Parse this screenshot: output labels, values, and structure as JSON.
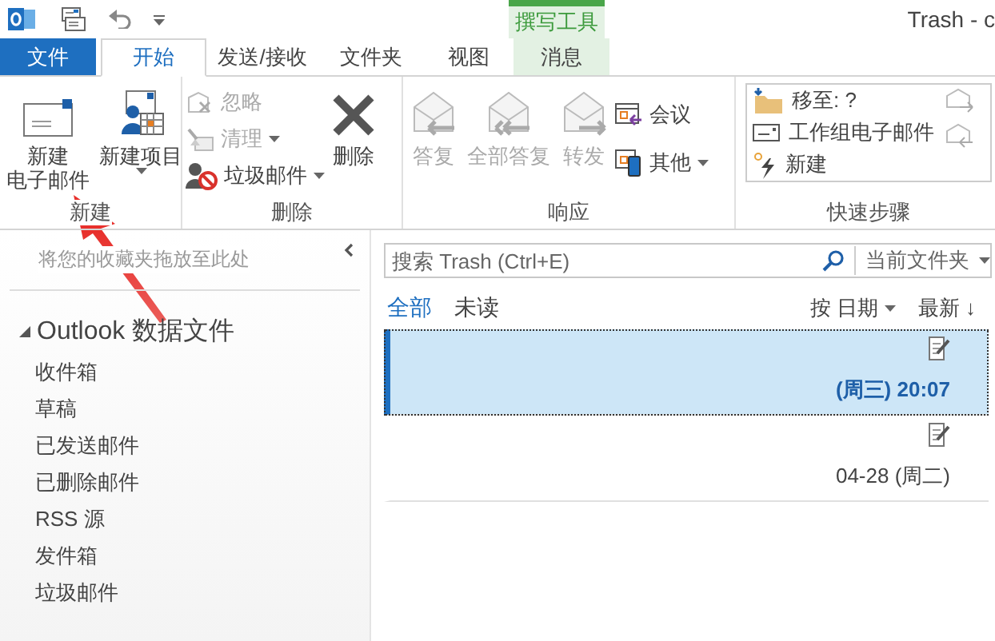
{
  "title_bar": {
    "title": "Trash - c",
    "context_group": "撰写工具"
  },
  "tabs": [
    {
      "label": "文件",
      "kind": "backstage",
      "selected": false
    },
    {
      "label": "开始",
      "kind": "normal",
      "selected": true
    },
    {
      "label": "发送/接收",
      "kind": "normal",
      "selected": false
    },
    {
      "label": "文件夹",
      "kind": "normal",
      "selected": false
    },
    {
      "label": "视图",
      "kind": "normal",
      "selected": false
    },
    {
      "label": "消息",
      "kind": "contextual",
      "selected": false
    }
  ],
  "ribbon": {
    "groups": [
      {
        "label": "新建",
        "items": [
          {
            "kind": "large",
            "label_lines": [
              "新建",
              "电子邮件"
            ],
            "disabled": false,
            "dropdown": false
          },
          {
            "kind": "large",
            "label": "新建项目",
            "disabled": false,
            "dropdown": true
          }
        ]
      },
      {
        "label": "删除",
        "items": [
          {
            "kind": "small",
            "label": "忽略",
            "disabled": true,
            "dropdown": false
          },
          {
            "kind": "small",
            "label": "清理",
            "disabled": true,
            "dropdown": true
          },
          {
            "kind": "small",
            "label": "垃圾邮件",
            "disabled": false,
            "dropdown": true
          },
          {
            "kind": "large",
            "label": "删除",
            "disabled": false,
            "dropdown": false
          }
        ]
      },
      {
        "label": "响应",
        "items": [
          {
            "kind": "large",
            "label": "答复",
            "disabled": true,
            "dropdown": false
          },
          {
            "kind": "large",
            "label": "全部答复",
            "disabled": true,
            "dropdown": false
          },
          {
            "kind": "large",
            "label": "转发",
            "disabled": true,
            "dropdown": false
          },
          {
            "kind": "small",
            "label": "会议",
            "disabled": false,
            "dropdown": false
          },
          {
            "kind": "small",
            "label": "其他",
            "disabled": false,
            "dropdown": true
          }
        ]
      },
      {
        "label": "快速步骤",
        "items": [
          {
            "kind": "gallery",
            "label": "移至: ?",
            "disabled": false
          },
          {
            "kind": "gallery",
            "label": "工作组电子邮件",
            "disabled": false
          },
          {
            "kind": "gallery",
            "label": "新建",
            "disabled": false
          }
        ]
      }
    ]
  },
  "sidebar": {
    "favorites_placeholder": "将您的收藏夹拖放至此处",
    "tree": [
      {
        "label": "Outlook 数据文件",
        "expanded": true,
        "children": [
          {
            "label": "收件箱"
          },
          {
            "label": "草稿"
          },
          {
            "label": "已发送邮件"
          },
          {
            "label": "已删除邮件"
          },
          {
            "label": "RSS 源"
          },
          {
            "label": "发件箱"
          },
          {
            "label": "垃圾邮件"
          }
        ]
      }
    ]
  },
  "search": {
    "placeholder": "搜索 Trash (Ctrl+E)",
    "scope": "当前文件夹"
  },
  "filters": [
    {
      "label": "全部",
      "selected": true
    },
    {
      "label": "未读",
      "selected": false
    }
  ],
  "sort": {
    "by": "按 日期",
    "order": "最新 ↓"
  },
  "messages": [
    {
      "time": "(周三) 20:07",
      "selected": true,
      "unread": true
    },
    {
      "time": "04-28 (周二)",
      "selected": false,
      "unread": false
    }
  ]
}
